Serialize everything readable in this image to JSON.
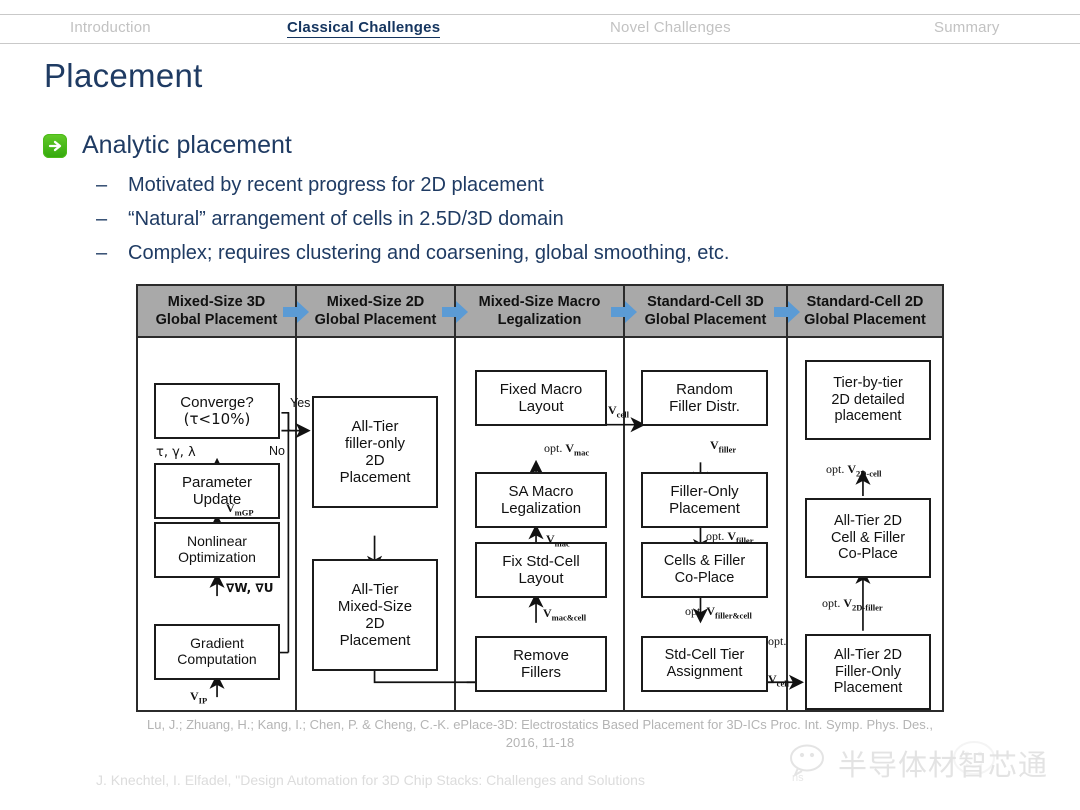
{
  "nav": {
    "items": [
      {
        "label": "Introduction",
        "active": false
      },
      {
        "label": "Classical Challenges",
        "active": true
      },
      {
        "label": "Novel Challenges",
        "active": false
      },
      {
        "label": "Summary",
        "active": false
      }
    ]
  },
  "slide": {
    "title": "Placement",
    "bullet_icon": "green-arrow-icon",
    "main_bullet": "Analytic placement",
    "dash": "–",
    "sub_bullets": [
      "Motivated by recent progress for 2D placement",
      "“Natural” arrangement of cells in 2.5D/3D domain",
      "Complex; requires clustering and coarsening, global smoothing, etc."
    ]
  },
  "diagram": {
    "header_arrow_color": "#5b9bd5",
    "header_bg": "#a9a9a9",
    "columns": [
      {
        "header": [
          "Mixed-Size 3D",
          "Global Placement"
        ],
        "nodes": [
          {
            "lines": [
              "Converge?",
              "(τ<10%)"
            ]
          },
          {
            "lines": [
              "Parameter",
              "Update"
            ]
          },
          {
            "lines": [
              "Nonlinear",
              "Optimization"
            ]
          },
          {
            "lines": [
              "Gradient",
              "Computation"
            ]
          }
        ],
        "edge_labels": [
          "τ, γ, λ",
          "V",
          "∇W, ∇U",
          "V"
        ],
        "sub_mgp": "mGP",
        "sub_ip": "IP",
        "label_vip": "V",
        "branch_yes": "Yes",
        "branch_no": "No"
      },
      {
        "header": [
          "Mixed-Size 2D",
          "Global Placement"
        ],
        "nodes": [
          {
            "lines": [
              "All-Tier",
              "filler-only",
              "2D",
              "Placement"
            ]
          },
          {
            "lines": [
              "All-Tier",
              "Mixed-Size",
              "2D",
              "Placement"
            ]
          }
        ]
      },
      {
        "header": [
          "Mixed-Size Macro",
          "Legalization"
        ],
        "nodes": [
          {
            "lines": [
              "Fixed Macro",
              "Layout"
            ]
          },
          {
            "lines": [
              "SA Macro",
              "Legalization"
            ]
          },
          {
            "lines": [
              "Fix Std-Cell",
              "Layout"
            ]
          },
          {
            "lines": [
              "Remove",
              "Fillers"
            ]
          }
        ],
        "edge_labels": [
          {
            "prefix": "opt. ",
            "v": "V",
            "sub": "mac"
          },
          {
            "prefix": "",
            "v": "V",
            "sub": "mac"
          },
          {
            "prefix": "",
            "v": "V",
            "sub": "mac&cell"
          }
        ],
        "out_label": {
          "v": "V",
          "sub": "cell"
        }
      },
      {
        "header": [
          "Standard-Cell 3D",
          "Global Placement"
        ],
        "nodes": [
          {
            "lines": [
              "Random",
              "Filler Distr."
            ]
          },
          {
            "lines": [
              "Filler-Only",
              "Placement"
            ]
          },
          {
            "lines": [
              "Cells & Filler",
              "Co-Place"
            ]
          },
          {
            "lines": [
              "Std-Cell Tier",
              "Assignment"
            ]
          }
        ],
        "edge_labels": [
          {
            "prefix": "",
            "v": "V",
            "sub": "filler"
          },
          {
            "prefix": "opt. ",
            "v": "V",
            "sub": "filler"
          },
          {
            "prefix": "opt. ",
            "v": "V",
            "sub": "filler&cell"
          }
        ],
        "out_label": {
          "prefix": "opt.",
          "v": "V",
          "sub": "cell"
        }
      },
      {
        "header": [
          "Standard-Cell 2D",
          "Global Placement"
        ],
        "nodes": [
          {
            "lines": [
              "Tier-by-tier",
              "2D detailed",
              "placement"
            ]
          },
          {
            "lines": [
              "All-Tier 2D",
              "Cell & Filler",
              "Co-Place"
            ]
          },
          {
            "lines": [
              "All-Tier 2D",
              "Filler-Only",
              "Placement"
            ]
          }
        ],
        "edge_labels": [
          {
            "prefix": "opt. ",
            "v": "V",
            "sub": "2D-cell"
          },
          {
            "prefix": "opt. ",
            "v": "V",
            "sub": "2D-filler"
          }
        ]
      }
    ]
  },
  "citation": "Lu, J.; Zhuang, H.; Kang, I.; Chen, P. & Cheng, C.-K. ePlace-3D: Electrostatics Based Placement for 3D-ICs Proc. Int. Symp. Phys. Des., 2016, 11-18",
  "footer": "J. Knechtel, I. Elfadel, \"Design Automation for 3D Chip Stacks: Challenges and Solutions",
  "watermark": {
    "text": "半导体材智芯通",
    "sub": "ns",
    "logo": "wechat-icon"
  }
}
